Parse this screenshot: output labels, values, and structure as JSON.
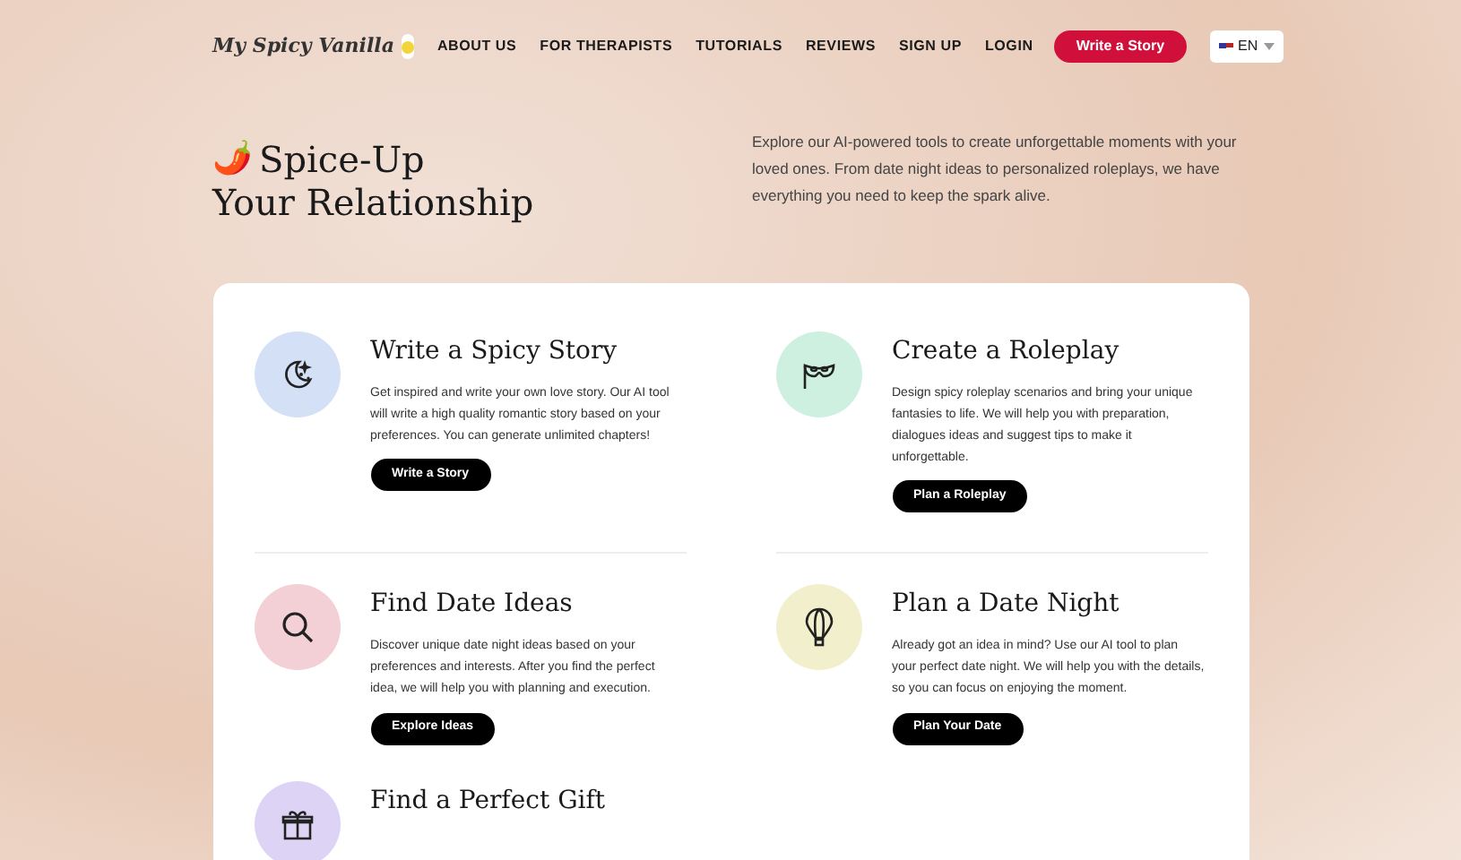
{
  "header": {
    "logo": "My Spicy Vanilla",
    "nav": [
      "ABOUT US",
      "FOR THERAPISTS",
      "TUTORIALS",
      "REVIEWS",
      "SIGN UP",
      "LOGIN"
    ],
    "cta": "Write a Story",
    "language": "EN"
  },
  "hero": {
    "emoji": "🌶️",
    "title_line1": "Spice-Up",
    "title_line2": "Your Relationship",
    "text": "Explore our AI-powered tools to create unforgettable moments with your loved ones. From date night ideas to personalized roleplays, we have everything you need to keep the spark alive."
  },
  "features": [
    {
      "kind": "moon",
      "color": "#d3e0f5",
      "title": "Write a Spicy Story",
      "text": "Get inspired and write your own love story. Our AI tool will write a high quality romantic story based on your preferences. You can generate unlimited chapters!",
      "button": "Write a Story"
    },
    {
      "kind": "mask",
      "color": "#cdf0e0",
      "title": "Create a Roleplay",
      "text": "Design spicy roleplay scenarios and bring your unique fantasies to life. We will help you with preparation, dialogues ideas and suggest tips to make it unforgettable.",
      "button": "Plan a Roleplay"
    },
    {
      "kind": "search",
      "color": "#f3cfd6",
      "title": "Find Date Ideas",
      "text": "Discover unique date night ideas based on your preferences and interests. After you find the perfect idea, we will help you with planning and execution.",
      "button": "Explore Ideas"
    },
    {
      "kind": "balloon",
      "color": "#f2f0cc",
      "title": "Plan a Date Night",
      "text": "Already got an idea in mind? Use our AI tool to plan your perfect date night. We will help you with the details, so you can focus on enjoying the moment.",
      "button": "Plan Your Date"
    },
    {
      "kind": "gift",
      "color": "#ddd4f5",
      "title": "Find a Perfect Gift"
    }
  ]
}
